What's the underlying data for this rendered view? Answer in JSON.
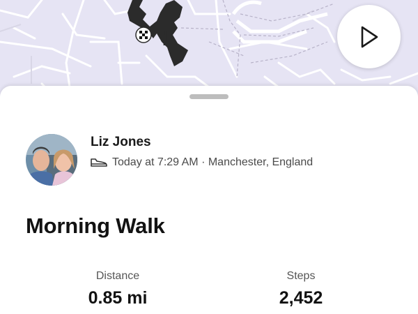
{
  "map": {
    "background": "#e6e4f4",
    "route_color": "#2b2b2b",
    "finish_marker_icon": "checkered-flag-icon",
    "play_icon": "play-icon"
  },
  "athlete": {
    "name": "Liz Jones",
    "avatar": "profile-photo-avatar"
  },
  "activity": {
    "sport_icon": "shoe-icon",
    "meta": "Today at 7:29 AM · Manchester, England",
    "title": "Morning Walk"
  },
  "stats": [
    {
      "label": "Distance",
      "value": "0.85 mi"
    },
    {
      "label": "Steps",
      "value": "2,452"
    }
  ]
}
